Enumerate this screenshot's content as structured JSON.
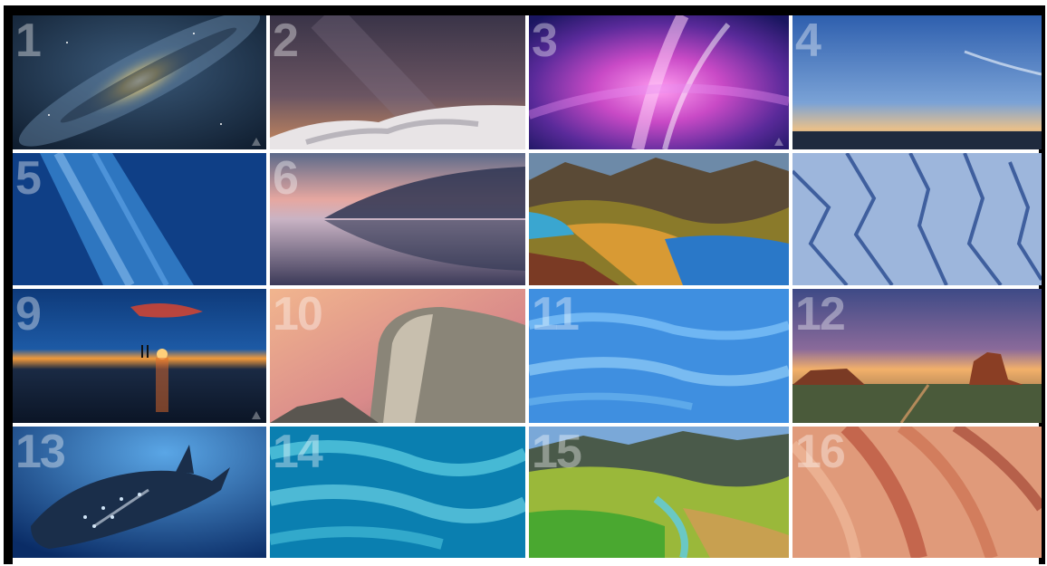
{
  "tiles": [
    {
      "number": "1"
    },
    {
      "number": "2"
    },
    {
      "number": "3"
    },
    {
      "number": "4"
    },
    {
      "number": "5"
    },
    {
      "number": "6"
    },
    {
      "number": ""
    },
    {
      "number": ""
    },
    {
      "number": "9"
    },
    {
      "number": "10"
    },
    {
      "number": "11"
    },
    {
      "number": "12"
    },
    {
      "number": "13"
    },
    {
      "number": "14"
    },
    {
      "number": "15"
    },
    {
      "number": "16"
    }
  ],
  "colors": {
    "frame": "#000000",
    "gutter": "#ffffff"
  }
}
